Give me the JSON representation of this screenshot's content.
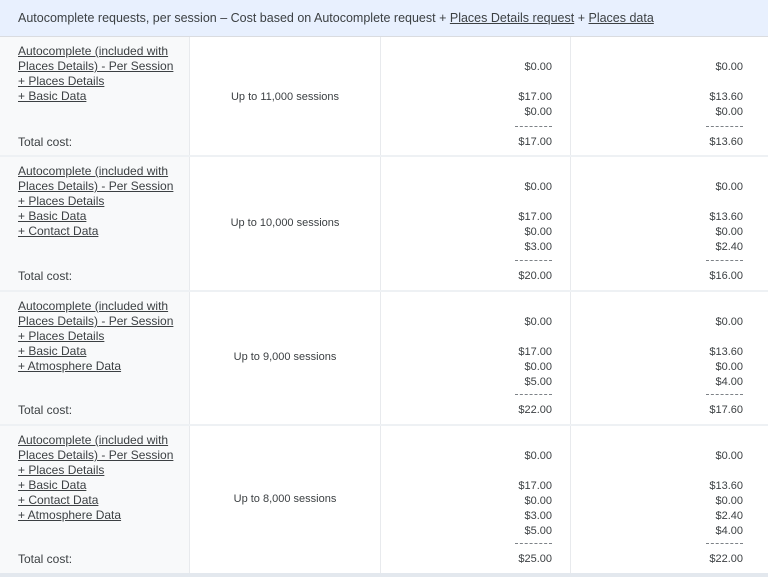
{
  "header": {
    "prefix": "Autocomplete requests, per session – Cost based on Autocomplete request + ",
    "link1": "Places Details request",
    "joiner": " + ",
    "link2": "Places data"
  },
  "total_label": "Total cost:",
  "rows": [
    {
      "items": [
        "Autocomplete (included with Places Details) - Per Session",
        "+ Places Details",
        "+ Basic Data"
      ],
      "sessions": "Up to 11,000 sessions",
      "col3": {
        "lines": [
          "$0.00",
          "",
          "$17.00",
          "$0.00"
        ],
        "total": "$17.00"
      },
      "col4": {
        "lines": [
          "$0.00",
          "",
          "$13.60",
          "$0.00"
        ],
        "total": "$13.60"
      }
    },
    {
      "items": [
        "Autocomplete (included with Places Details) - Per Session",
        "+ Places Details",
        "+ Basic Data",
        "+ Contact Data"
      ],
      "sessions": "Up to 10,000 sessions",
      "col3": {
        "lines": [
          "$0.00",
          "",
          "$17.00",
          "$0.00",
          "$3.00"
        ],
        "total": "$20.00"
      },
      "col4": {
        "lines": [
          "$0.00",
          "",
          "$13.60",
          "$0.00",
          "$2.40"
        ],
        "total": "$16.00"
      }
    },
    {
      "items": [
        "Autocomplete (included with Places Details) - Per Session",
        "+ Places Details",
        "+ Basic Data",
        "+ Atmosphere Data"
      ],
      "sessions": "Up to 9,000 sessions",
      "col3": {
        "lines": [
          "$0.00",
          "",
          "$17.00",
          "$0.00",
          "$5.00"
        ],
        "total": "$22.00"
      },
      "col4": {
        "lines": [
          "$0.00",
          "",
          "$13.60",
          "$0.00",
          "$4.00"
        ],
        "total": "$17.60"
      }
    },
    {
      "items": [
        "Autocomplete (included with Places Details) - Per Session",
        "+ Places Details",
        "+ Basic Data",
        "+ Contact Data",
        "+ Atmosphere Data"
      ],
      "sessions": "Up to 8,000 sessions",
      "col3": {
        "lines": [
          "$0.00",
          "",
          "$17.00",
          "$0.00",
          "$3.00",
          "$5.00"
        ],
        "total": "$25.00"
      },
      "col4": {
        "lines": [
          "$0.00",
          "",
          "$13.60",
          "$0.00",
          "$2.40",
          "$4.00"
        ],
        "total": "$22.00"
      }
    }
  ]
}
